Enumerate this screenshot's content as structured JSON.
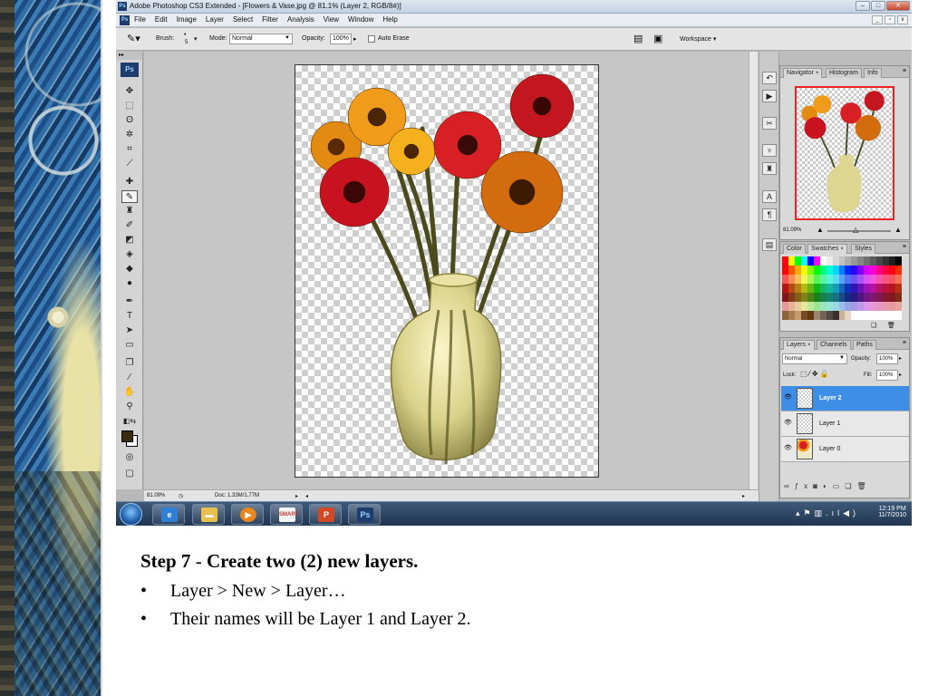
{
  "window": {
    "title": "Adobe Photoshop CS3 Extended - [Flowers & Vase.jpg @ 81.1% (Layer 2, RGB/8#)]"
  },
  "menubar": {
    "items": [
      "File",
      "Edit",
      "Image",
      "Layer",
      "Select",
      "Filter",
      "Analysis",
      "View",
      "Window",
      "Help"
    ]
  },
  "options": {
    "brush_label": "Brush:",
    "brush_size": "5",
    "mode_label": "Mode:",
    "mode_value": "Normal",
    "opacity_label": "Opacity:",
    "opacity_value": "100%",
    "auto_erase_label": "Auto Erase",
    "workspace_label": "Workspace ▾"
  },
  "status": {
    "zoom": "81.09%",
    "doc": "Doc: 1.33M/1.77M"
  },
  "navigator": {
    "tabs": [
      "Navigator",
      "Histogram",
      "Info"
    ],
    "zoom": "81.09%"
  },
  "color_panel": {
    "tabs": [
      "Color",
      "Swatches",
      "Styles"
    ]
  },
  "layers_panel": {
    "tabs": [
      "Layers",
      "Channels",
      "Paths"
    ],
    "blend_mode": "Normal",
    "opacity_label": "Opacity:",
    "opacity_value": "100%",
    "lock_label": "Lock:",
    "fill_label": "Fill:",
    "fill_value": "100%",
    "layers": [
      {
        "name": "Layer 2",
        "selected": true
      },
      {
        "name": "Layer 1",
        "selected": false
      },
      {
        "name": "Layer 0",
        "selected": false
      }
    ]
  },
  "taskbar": {
    "apps": [
      "ie-icon",
      "folder-icon",
      "media-player-icon",
      "smart-icon",
      "powerpoint-icon",
      "photoshop-icon"
    ],
    "ps_label": "Ps",
    "time": "12:19 PM",
    "date": "11/7/2010"
  },
  "caption": {
    "step_number": "Step 7",
    "step_separator": "-",
    "step_title": "Create two (2) new layers.",
    "bullets": [
      "Layer > New > Layer…",
      "Their names will be Layer 1 and Layer 2."
    ]
  },
  "colors": {
    "selection_blue": "#3e8ee7",
    "ps_blue": "#1c3d6e"
  }
}
